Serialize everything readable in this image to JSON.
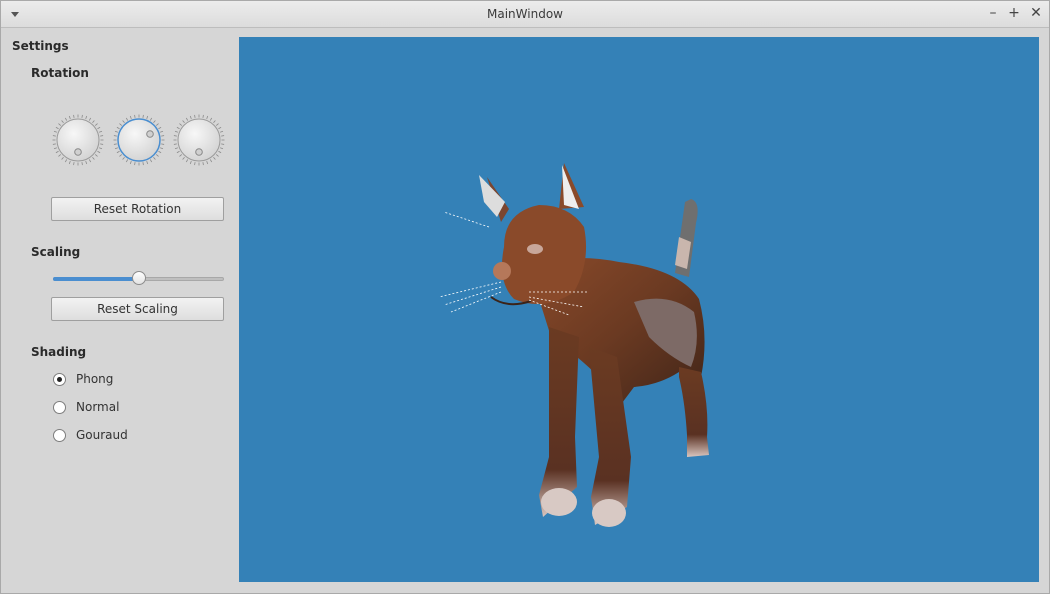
{
  "window": {
    "title": "MainWindow"
  },
  "sidebar": {
    "settings_label": "Settings",
    "rotation": {
      "label": "Rotation",
      "reset_label": "Reset Rotation"
    },
    "scaling": {
      "label": "Scaling",
      "reset_label": "Reset Scaling",
      "value_fraction": 0.5
    },
    "shading": {
      "label": "Shading",
      "options": [
        {
          "label": "Phong",
          "checked": true
        },
        {
          "label": "Normal",
          "checked": false
        },
        {
          "label": "Gouraud",
          "checked": false
        }
      ]
    }
  },
  "viewport": {
    "background": "#3481b7",
    "accent": "#4a8ed0"
  }
}
